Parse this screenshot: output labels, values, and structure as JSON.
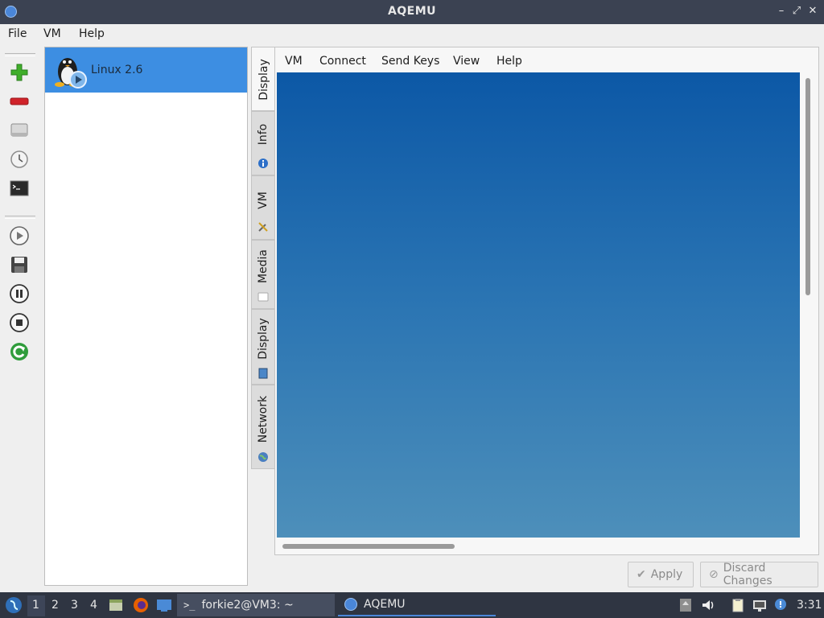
{
  "window": {
    "title": "AQEMU"
  },
  "menubar": {
    "items": [
      "File",
      "VM",
      "Help"
    ]
  },
  "vm_list": {
    "items": [
      {
        "label": "Linux 2.6",
        "selected": true
      }
    ]
  },
  "tabs": [
    "Display",
    "Info",
    "VM",
    "Media",
    "Display",
    "Network"
  ],
  "display_menu": {
    "items": [
      "VM",
      "Connect",
      "Send Keys",
      "View",
      "Help"
    ]
  },
  "buttons": {
    "apply": "Apply",
    "discard": "Discard Changes"
  },
  "taskbar": {
    "workspaces": [
      "1",
      "2",
      "3",
      "4"
    ],
    "tasks": [
      {
        "label": "forkie2@VM3: ~"
      },
      {
        "label": "AQEMU"
      }
    ],
    "clock": "3:31"
  },
  "colors": {
    "selection": "#3d8ee2",
    "screen_top": "#0c58a6",
    "screen_bottom": "#4d8fba",
    "taskbar": "#2f3542"
  }
}
